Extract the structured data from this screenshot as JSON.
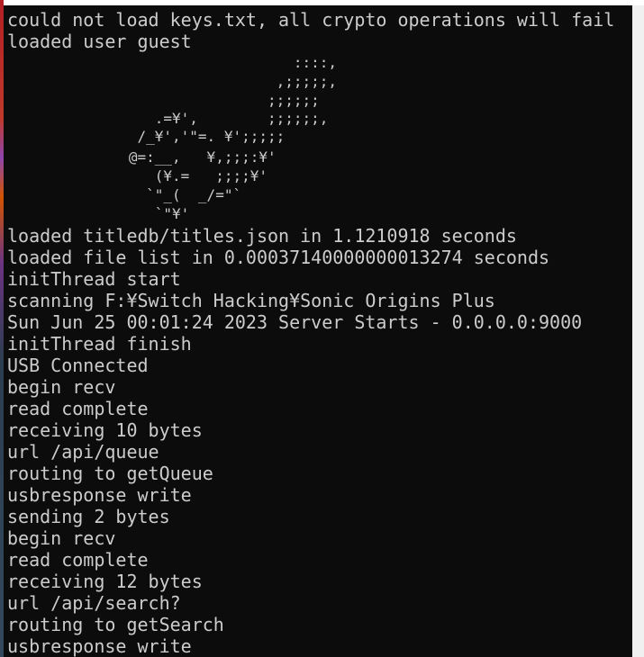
{
  "terminal": {
    "lines": [
      "could not load keys.txt, all crypto operations will fail",
      "loaded user guest",
      "loaded titledb/titles.json in 1.1210918 seconds",
      "loaded file list in 0.00037140000000013274 seconds",
      "initThread start",
      "scanning F:¥Switch Hacking¥Sonic Origins Plus",
      "Sun Jun 25 00:01:24 2023 Server Starts - 0.0.0.0:9000",
      "initThread finish",
      "USB Connected",
      "begin recv",
      "read complete",
      "receiving 10 bytes",
      "url /api/queue",
      "routing to getQueue",
      "usbresponse write",
      "sending 2 bytes",
      "begin recv",
      "read complete",
      "receiving 12 bytes",
      "url /api/search?",
      "routing to getSearch",
      "usbresponse write"
    ],
    "ascii_art": [
      "                                 ::::,",
      "                               ,;;;;;,",
      "                              ;;;;;;",
      "                 .=¥',        ;;;;;;,",
      "               /_¥','\"=. ¥';;;;;",
      "              @=:__,   ¥,;;;:¥'",
      "                 (¥.=   ;;;;¥'",
      "                `\"_(  _/=\"`",
      "                 `\"¥'"
    ]
  }
}
